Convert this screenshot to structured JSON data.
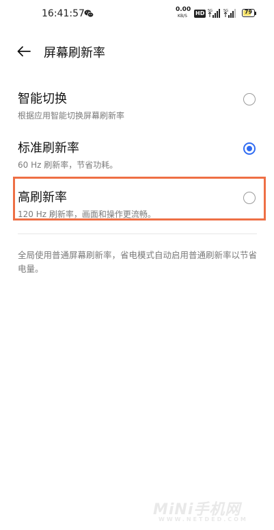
{
  "status_bar": {
    "time": "16:41:57",
    "net_speed_value": "0.00",
    "net_speed_unit": "KB/S",
    "hd_badge": "HD",
    "battery_level": 79,
    "battery_text": "79"
  },
  "header": {
    "title": "屏幕刷新率",
    "back_icon": "arrow-left-icon"
  },
  "options": [
    {
      "title": "智能切换",
      "desc": "根据应用智能切换屏幕刷新率",
      "selected": false
    },
    {
      "title": "标准刷新率",
      "desc": "60 Hz 刷新率，节省功耗。",
      "selected": true
    },
    {
      "title": "高刷新率",
      "desc": "120 Hz 刷新率，画面和操作更流畅。",
      "selected": false
    }
  ],
  "footnote": "全局使用普通屏幕刷新率，省电模式自动启用普通刷新率以节省电量。",
  "watermark": {
    "logo": "MiNi手机网",
    "sub": "WWW.NETDED.COM"
  },
  "colors": {
    "accent": "#2f6bf2",
    "highlight": "#ee6f45",
    "battery": "#f3e06a"
  }
}
